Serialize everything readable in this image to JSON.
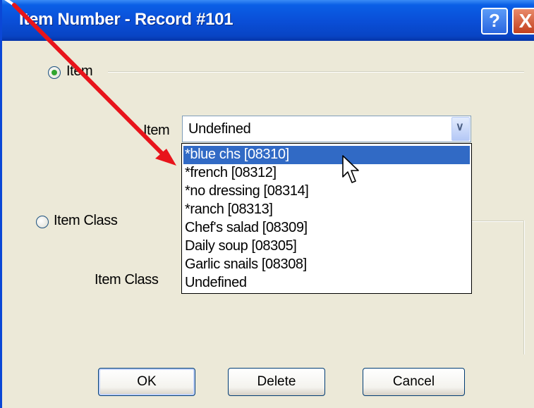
{
  "window": {
    "title": "Item Number - Record #101",
    "help_label": "?",
    "close_label": "X"
  },
  "item_option": {
    "radio_label": "Item",
    "selected": true,
    "field_label": "Item",
    "combo_value": "Undefined",
    "dropdown_icon": "chevron-down-icon",
    "options": [
      "*blue chs [08310]",
      "*french [08312]",
      "*no dressing [08314]",
      "*ranch [08313]",
      "Chef's salad [08309]",
      "Daily soup [08305]",
      "Garlic snails [08308]",
      "Undefined"
    ],
    "highlighted_option": "*blue chs [08310]"
  },
  "item_class_option": {
    "radio_label": "Item Class",
    "selected": false,
    "field_label": "Item Class"
  },
  "buttons": {
    "ok": "OK",
    "delete": "Delete",
    "cancel": "Cancel"
  },
  "colors": {
    "titlebar": "#0a4fd8",
    "selection": "#316ac5",
    "annotation_arrow": "#e8141b",
    "dialog_face": "#ece9d8"
  }
}
